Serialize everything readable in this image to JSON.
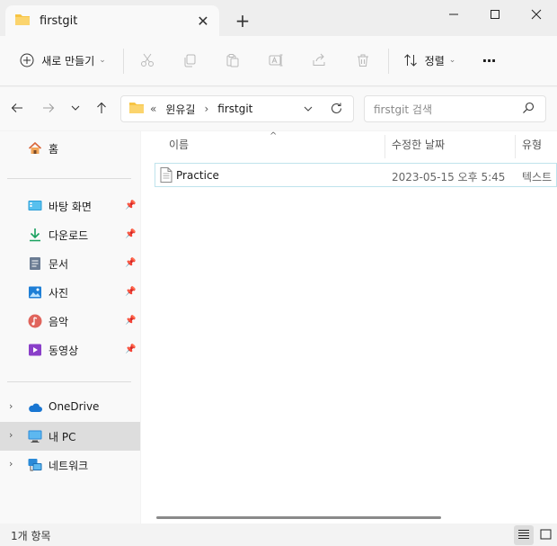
{
  "window": {
    "tab_title": "firstgit",
    "new_tab_symbol": "+",
    "close_tab_symbol": "✕"
  },
  "toolbar": {
    "new_label": "새로 만들기",
    "sort_label": "정렬",
    "more_symbol": "···",
    "caret": "⌄"
  },
  "address": {
    "overflow": "«",
    "crumbs": [
      "윈유길",
      "firstgit"
    ],
    "separator": "›"
  },
  "search": {
    "placeholder": "firstgit 검색"
  },
  "sidebar": {
    "home": "홈",
    "quick": [
      "바탕 화면",
      "다운로드",
      "문서",
      "사진",
      "음악",
      "동영상"
    ],
    "tree": [
      "OneDrive",
      "내 PC",
      "네트워크"
    ]
  },
  "columns": {
    "name": "이름",
    "modified": "수정한 날짜",
    "type": "유형"
  },
  "files": [
    {
      "name": "Practice",
      "modified": "2023-05-15 오후 5:45",
      "type": "텍스트"
    }
  ],
  "status": {
    "count": "1개 항목"
  },
  "colors": {
    "accent": "#0067c0",
    "folder": "#f7c443"
  }
}
